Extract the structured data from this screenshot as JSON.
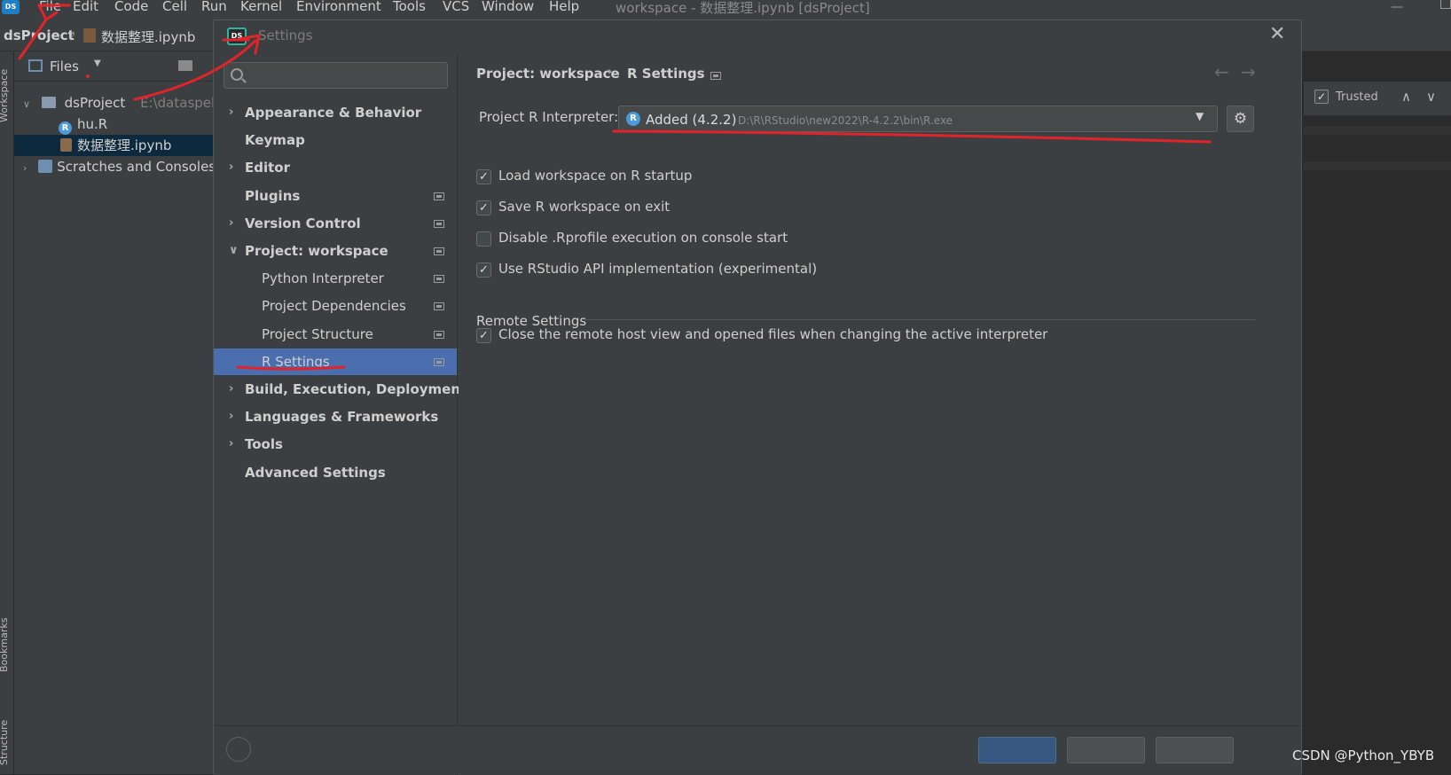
{
  "ide": {
    "menus": [
      "File",
      "Edit",
      "Code",
      "Cell",
      "Run",
      "Kernel",
      "Environment",
      "Tools",
      "VCS",
      "Window",
      "Help"
    ],
    "window_title": "workspace - 数据整理.ipynb [dsProject]",
    "breadcrumb_project": "dsProject",
    "breadcrumb_file": "数据整理.ipynb",
    "left_tabs": [
      "Workspace",
      "Bookmarks",
      "Structure"
    ],
    "files_panel": {
      "title": "Files",
      "tree": [
        {
          "label": "dsProject",
          "suffix": "E:\\dataspell\\",
          "type": "folder",
          "expanded": true
        },
        {
          "label": "hu.R",
          "type": "r-file"
        },
        {
          "label": "数据整理.ipynb",
          "type": "notebook",
          "selected": true
        },
        {
          "label": "Scratches and Consoles",
          "type": "scratch"
        }
      ]
    },
    "editor_toolbar": {
      "trusted_label": "Trusted",
      "trusted_checked": true
    }
  },
  "dialog": {
    "logo_text": "DS",
    "title": "Settings",
    "search_placeholder": "",
    "sidebar": [
      {
        "label": "Appearance & Behavior",
        "bold": true,
        "arrow": "right",
        "indent": 0,
        "icon": false
      },
      {
        "label": "Keymap",
        "bold": true,
        "arrow": "",
        "indent": 0,
        "icon": false
      },
      {
        "label": "Editor",
        "bold": true,
        "arrow": "right",
        "indent": 0,
        "icon": false
      },
      {
        "label": "Plugins",
        "bold": true,
        "arrow": "",
        "indent": 0,
        "icon": true
      },
      {
        "label": "Version Control",
        "bold": true,
        "arrow": "right",
        "indent": 0,
        "icon": true
      },
      {
        "label": "Project: workspace",
        "bold": true,
        "arrow": "down",
        "indent": 0,
        "icon": true
      },
      {
        "label": "Python Interpreter",
        "bold": false,
        "arrow": "",
        "indent": 1,
        "icon": true
      },
      {
        "label": "Project Dependencies",
        "bold": false,
        "arrow": "",
        "indent": 1,
        "icon": true
      },
      {
        "label": "Project Structure",
        "bold": false,
        "arrow": "",
        "indent": 1,
        "icon": true
      },
      {
        "label": "R Settings",
        "bold": false,
        "arrow": "",
        "indent": 1,
        "icon": true,
        "selected": true
      },
      {
        "label": "Build, Execution, Deployment",
        "bold": true,
        "arrow": "right",
        "indent": 0,
        "icon": false
      },
      {
        "label": "Languages & Frameworks",
        "bold": true,
        "arrow": "right",
        "indent": 0,
        "icon": false
      },
      {
        "label": "Tools",
        "bold": true,
        "arrow": "right",
        "indent": 0,
        "icon": false
      },
      {
        "label": "Advanced Settings",
        "bold": true,
        "arrow": "",
        "indent": 0,
        "icon": false
      }
    ],
    "content": {
      "breadcrumb_project": "Project: workspace",
      "breadcrumb_page": "R Settings",
      "interpreter_label": "Project R Interpreter:",
      "interpreter_name": "Added (4.2.2)",
      "interpreter_path": "D:\\R\\RStudio\\new2022\\R-4.2.2\\bin\\R.exe",
      "checkboxes": [
        {
          "label": "Load workspace on R startup",
          "checked": true
        },
        {
          "label": "Save R workspace on exit",
          "checked": true
        },
        {
          "label": "Disable .Rprofile execution on console start",
          "checked": false
        },
        {
          "label": "Use RStudio API implementation (experimental)",
          "checked": true
        }
      ],
      "remote_title": "Remote Settings",
      "remote_checkbox": {
        "label": "Close the remote host view and opened files when changing the active interpreter",
        "checked": true
      }
    }
  },
  "watermark": "CSDN @Python_YBYB",
  "colors": {
    "background": "#2b2b2b",
    "panel": "#3c3f41",
    "selection": "#4b6eaf",
    "annotation": "#e0242a",
    "r_icon": "#4a9bd6"
  }
}
